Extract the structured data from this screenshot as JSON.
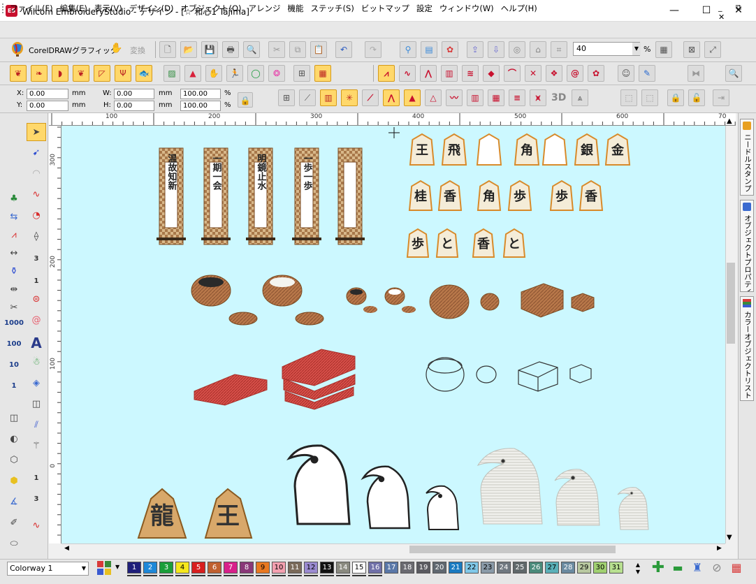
{
  "window": {
    "title": "Wilcom EmbroideryStudio - デザイン - [☆ 和心1        Tajima]",
    "app_badge": "ES",
    "controls": [
      "—",
      "☐",
      "✕"
    ]
  },
  "menu": {
    "items": [
      "ファイル(F)",
      "編集(E)",
      "表示(V)",
      "デザイン(D)",
      "オブジェクト(O)",
      "アレンジ",
      "機能",
      "ステッチ(S)",
      "ビットマップ",
      "設定",
      "ウィンドウ(W)",
      "ヘルプ(H)"
    ],
    "mdi_controls": "_ ⧉ ✕"
  },
  "toolbar1": {
    "coreldraw_label": "CorelDRAWグラフィック",
    "convert_label": "変換",
    "zoom_value": "40",
    "zoom_unit": "%"
  },
  "coords": {
    "x_label": "X:",
    "x_value": "0.00",
    "x_unit": "mm",
    "y_label": "Y:",
    "y_value": "0.00",
    "y_unit": "mm",
    "w_label": "W:",
    "w_value": "0.00",
    "w_unit": "mm",
    "h_label": "H:",
    "h_value": "0.00",
    "h_unit": "mm",
    "sx_value": "100.00",
    "sx_unit": "%",
    "sy_value": "100.00",
    "sy_unit": "%",
    "label_3d": "3D"
  },
  "toolbox": {
    "numbers": [
      "3",
      "1",
      "1000",
      "100",
      "10",
      "1",
      "1",
      "3"
    ]
  },
  "rulers": {
    "top": [
      "100",
      "200",
      "300",
      "400",
      "500",
      "600",
      "70"
    ],
    "left": [
      "300",
      "200",
      "100",
      "0"
    ]
  },
  "canvas": {
    "bg_color": "#ccf8ff",
    "shogi_top": [
      "王",
      "飛",
      "角",
      "金",
      "銀",
      "金"
    ],
    "shogi_mid": [
      "桂",
      "香",
      "角",
      "歩",
      "歩",
      "香"
    ],
    "shogi_low": [
      "歩",
      "と",
      "香",
      "と"
    ],
    "shogi_big": [
      "龍",
      "王"
    ],
    "scroll_texts": [
      "温故知新",
      "一期一会",
      "明鏡止水",
      "一歩一歩",
      ""
    ]
  },
  "docker": {
    "tabs": [
      "ニードルスタンプ",
      "オブジェクトプロパティ",
      "カラーオブジェクトリスト"
    ]
  },
  "colorway": {
    "label": "Colorway 1"
  },
  "palette": [
    {
      "n": "1",
      "color": "#1f1f7a",
      "text": "#fff"
    },
    {
      "n": "2",
      "color": "#1e88d8",
      "text": "#fff"
    },
    {
      "n": "3",
      "color": "#1a9e3a",
      "text": "#fff"
    },
    {
      "n": "4",
      "color": "#f5e71c",
      "text": "#000"
    },
    {
      "n": "5",
      "color": "#d81e1e",
      "text": "#fff"
    },
    {
      "n": "6",
      "color": "#c06030",
      "text": "#fff"
    },
    {
      "n": "7",
      "color": "#d8208a",
      "text": "#fff"
    },
    {
      "n": "8",
      "color": "#8a3878",
      "text": "#fff"
    },
    {
      "n": "9",
      "color": "#e87820",
      "text": "#000"
    },
    {
      "n": "10",
      "color": "#f4a0b0",
      "text": "#000"
    },
    {
      "n": "11",
      "color": "#7a6a5a",
      "text": "#fff"
    },
    {
      "n": "12",
      "color": "#9a8ad0",
      "text": "#000"
    },
    {
      "n": "13",
      "color": "#111111",
      "text": "#fff"
    },
    {
      "n": "14",
      "color": "#8a8a80",
      "text": "#fff"
    },
    {
      "n": "15",
      "color": "#ffffff",
      "text": "#000"
    },
    {
      "n": "16",
      "color": "#7070a8",
      "text": "#fff"
    },
    {
      "n": "17",
      "color": "#5a78a8",
      "text": "#fff"
    },
    {
      "n": "18",
      "color": "#6a6a70",
      "text": "#fff"
    },
    {
      "n": "19",
      "color": "#5a5a60",
      "text": "#fff"
    },
    {
      "n": "20",
      "color": "#606870",
      "text": "#fff"
    },
    {
      "n": "21",
      "color": "#1a7ac0",
      "text": "#fff"
    },
    {
      "n": "22",
      "color": "#80c8e8",
      "text": "#000"
    },
    {
      "n": "23",
      "color": "#8a9aa8",
      "text": "#000"
    },
    {
      "n": "24",
      "color": "#707880",
      "text": "#fff"
    },
    {
      "n": "25",
      "color": "#60686a",
      "text": "#fff"
    },
    {
      "n": "26",
      "color": "#4a8a7a",
      "text": "#fff"
    },
    {
      "n": "27",
      "color": "#5ab0b8",
      "text": "#000"
    },
    {
      "n": "28",
      "color": "#6a8aa0",
      "text": "#fff"
    },
    {
      "n": "29",
      "color": "#b8c8a0",
      "text": "#000"
    },
    {
      "n": "30",
      "color": "#a0d070",
      "text": "#000"
    },
    {
      "n": "31",
      "color": "#b8e090",
      "text": "#000"
    }
  ]
}
